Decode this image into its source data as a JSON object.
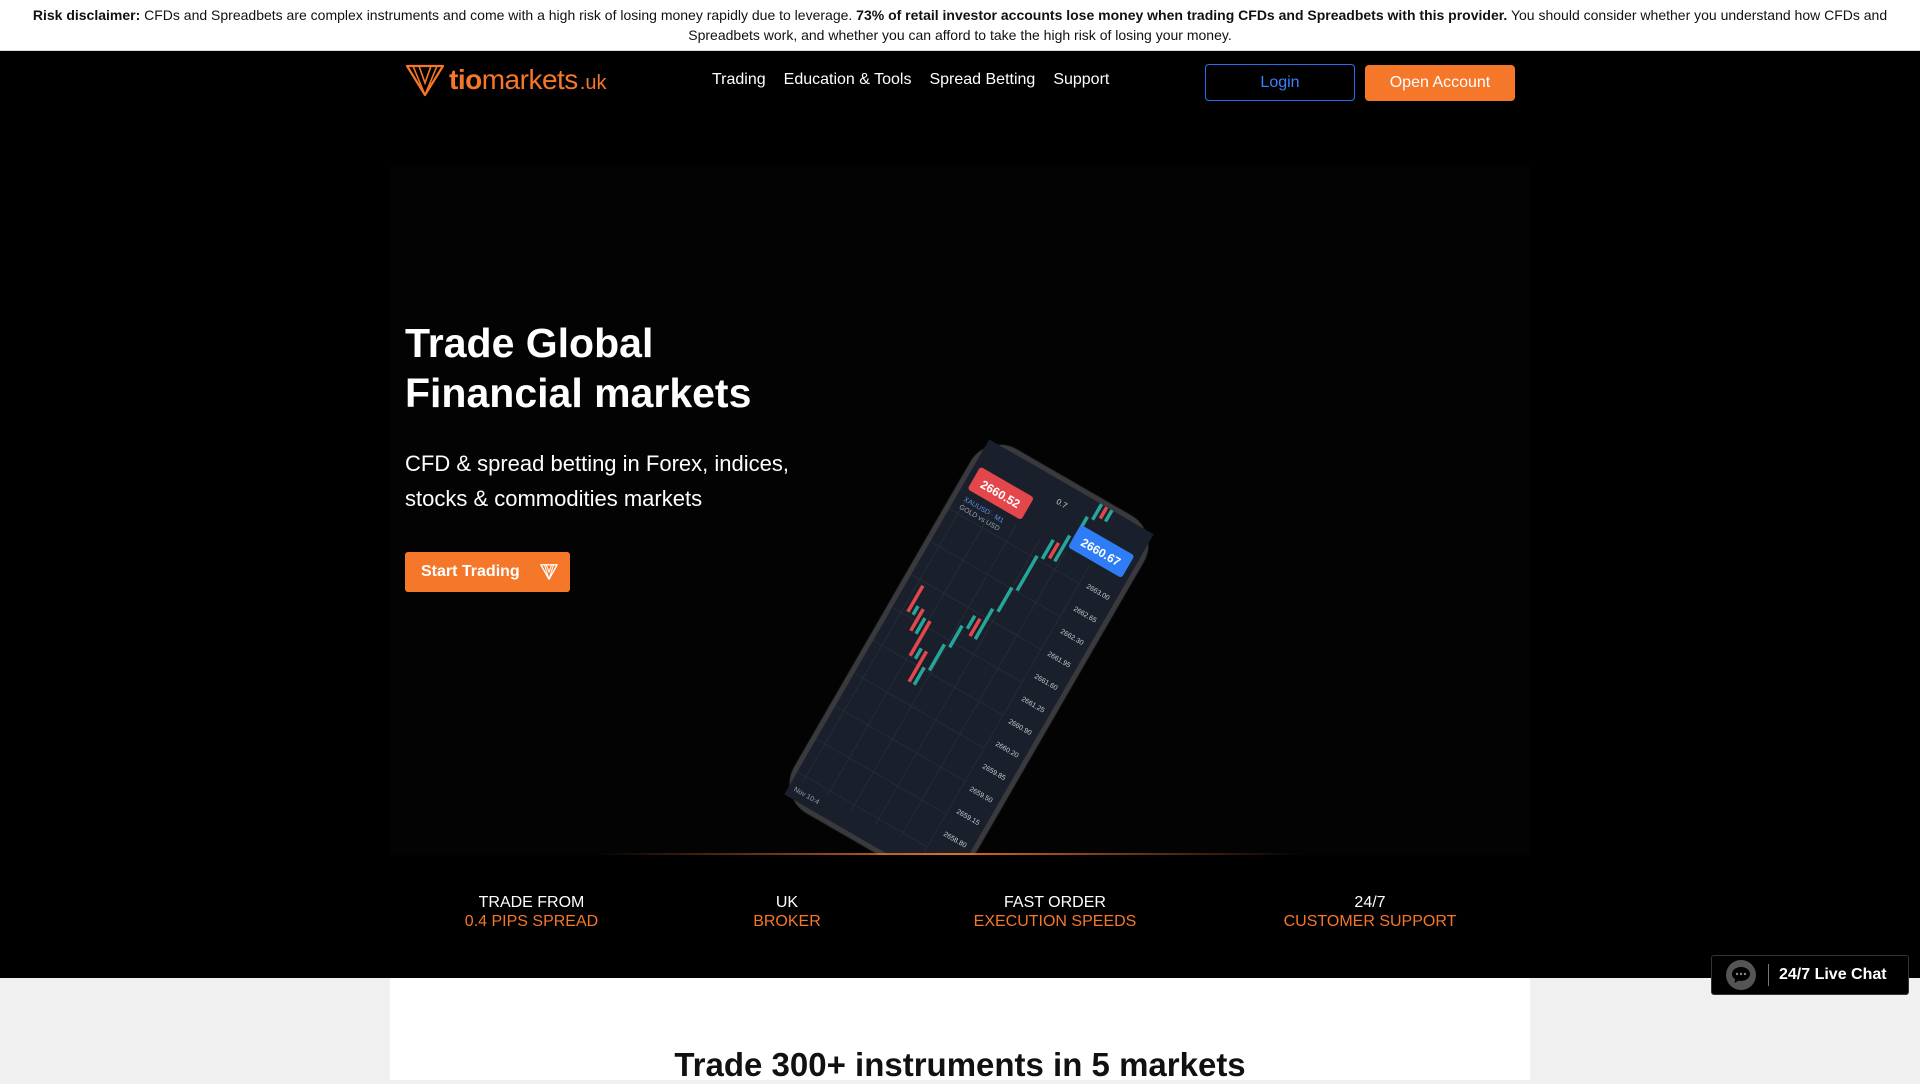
{
  "disclaimer": {
    "label": "Risk disclaimer:",
    "text1": " CFDs and Spreadbets are complex instruments and come with a high risk of losing money rapidly due to leverage. ",
    "bold": "73% of retail investor accounts lose money when trading CFDs and Spreadbets with this provider.",
    "text2": " You should consider whether you understand how CFDs and Spreadbets work, and whether you can afford to take the high risk of losing your money."
  },
  "header": {
    "logo_tio": "tio",
    "logo_markets": "markets",
    "logo_suffix": ".uk",
    "nav": [
      "Trading",
      "Education & Tools",
      "Spread Betting",
      "Support"
    ],
    "login_label": "Login",
    "open_account_label": "Open Account"
  },
  "hero": {
    "title_line1": "Trade Global",
    "title_line2": "Financial markets",
    "subtitle": "CFD & spread betting in Forex, indices, stocks & commodities markets",
    "cta_label": "Start Trading"
  },
  "phone_screen": {
    "ask_price": "2660.52",
    "bid_price": "2660.67",
    "symbol": "XAUUSD · M1",
    "symbol_desc": "GOLD vs USD",
    "spread": "0.7",
    "time_label": "Nov 10:4",
    "price_scale": [
      "2663.00",
      "2662.65",
      "2662.30",
      "2661.95",
      "2661.60",
      "2661.25",
      "2660.90",
      "2660.20",
      "2659.85",
      "2659.50",
      "2659.15",
      "2658.80"
    ]
  },
  "stats": [
    {
      "line1": "TRADE FROM",
      "line2": "0.4 PIPS SPREAD"
    },
    {
      "line1": "UK",
      "line2": "BROKER"
    },
    {
      "line1": "FAST ORDER",
      "line2": "EXECUTION SPEEDS"
    },
    {
      "line1": "24/7",
      "line2": "CUSTOMER SUPPORT"
    }
  ],
  "lower": {
    "title": "Trade 300+ instruments in 5 markets"
  },
  "live_chat": {
    "label": "24/7 Live Chat"
  },
  "colors": {
    "brand_orange": "#f5772a",
    "login_blue": "#2a6ee8"
  }
}
